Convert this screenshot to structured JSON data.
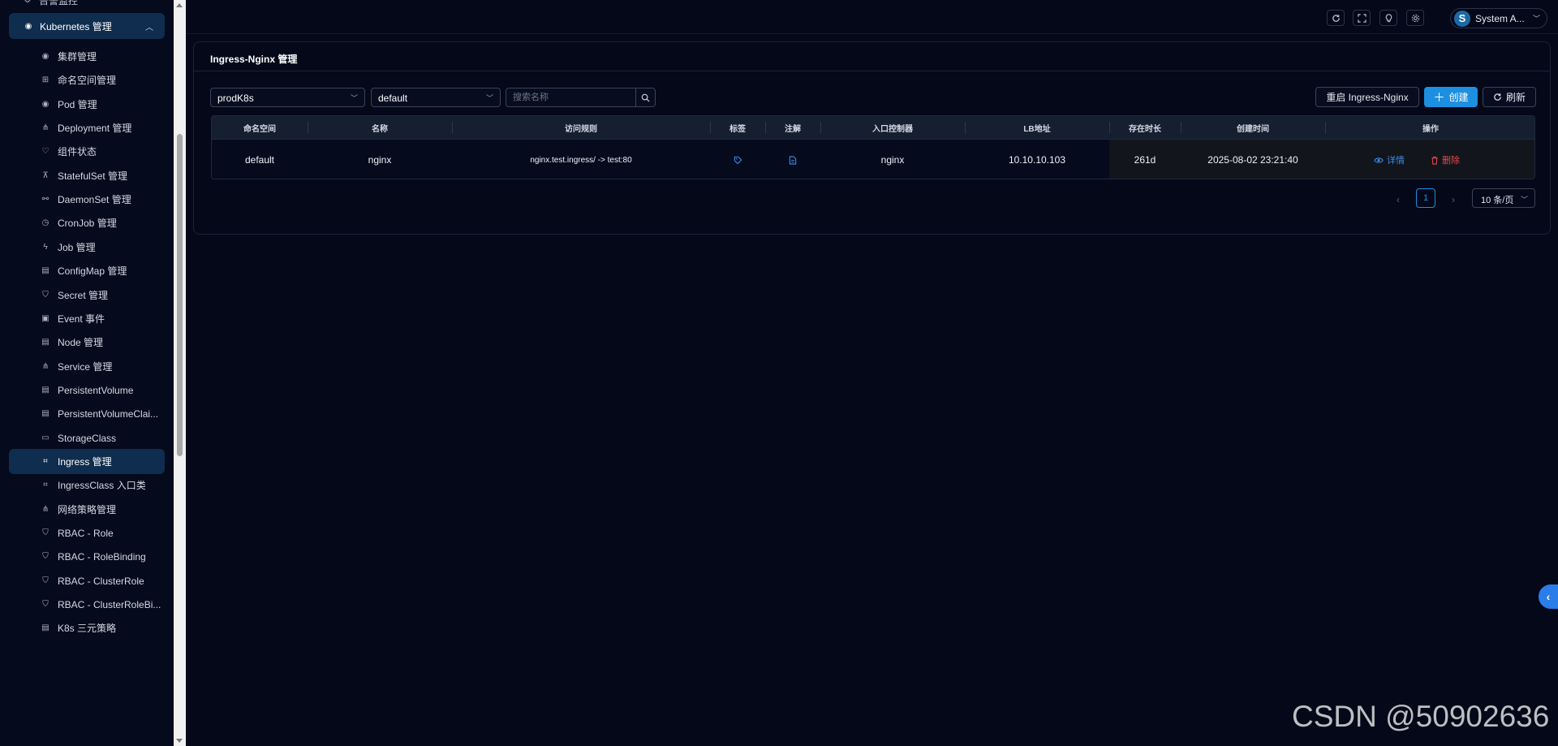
{
  "sidebar": {
    "top_partial": "告警监控",
    "group": {
      "label": "Kubernetes 管理",
      "icon": "kubernetes-icon"
    },
    "items": [
      {
        "label": "集群管理",
        "icon": "cluster-icon",
        "active": false
      },
      {
        "label": "命名空间管理",
        "icon": "grid-icon",
        "active": false
      },
      {
        "label": "Pod 管理",
        "icon": "pod-icon",
        "active": false
      },
      {
        "label": "Deployment 管理",
        "icon": "deployment-icon",
        "active": false
      },
      {
        "label": "组件状态",
        "icon": "heart-icon",
        "active": false
      },
      {
        "label": "StatefulSet 管理",
        "icon": "statefulset-icon",
        "active": false
      },
      {
        "label": "DaemonSet 管理",
        "icon": "daemonset-icon",
        "active": false
      },
      {
        "label": "CronJob 管理",
        "icon": "clock-icon",
        "active": false
      },
      {
        "label": "Job 管理",
        "icon": "lightning-icon",
        "active": false
      },
      {
        "label": "ConfigMap 管理",
        "icon": "file-icon",
        "active": false
      },
      {
        "label": "Secret 管理",
        "icon": "shield-icon",
        "active": false
      },
      {
        "label": "Event 事件",
        "icon": "event-icon",
        "active": false
      },
      {
        "label": "Node 管理",
        "icon": "node-icon",
        "active": false
      },
      {
        "label": "Service 管理",
        "icon": "service-icon",
        "active": false
      },
      {
        "label": "PersistentVolume",
        "icon": "volume-icon",
        "active": false
      },
      {
        "label": "PersistentVolumeClai...",
        "icon": "volume-claim-icon",
        "active": false
      },
      {
        "label": "StorageClass",
        "icon": "folder-icon",
        "active": false
      },
      {
        "label": "Ingress 管理",
        "icon": "ingress-icon",
        "active": true
      },
      {
        "label": "IngressClass 入口类",
        "icon": "ingress-class-icon",
        "active": false
      },
      {
        "label": "网络策略管理",
        "icon": "network-policy-icon",
        "active": false
      },
      {
        "label": "RBAC - Role",
        "icon": "shield-icon",
        "active": false
      },
      {
        "label": "RBAC - RoleBinding",
        "icon": "shield-icon",
        "active": false
      },
      {
        "label": "RBAC - ClusterRole",
        "icon": "shield-icon",
        "active": false
      },
      {
        "label": "RBAC - ClusterRoleBi...",
        "icon": "shield-icon",
        "active": false
      },
      {
        "label": "K8s 三元策略",
        "icon": "policy-icon",
        "active": false
      }
    ]
  },
  "header": {
    "buttons": [
      "refresh-icon",
      "fullscreen-icon",
      "lightbulb-icon",
      "settings-icon"
    ],
    "user": {
      "avatar_letter": "S",
      "name": "System A..."
    }
  },
  "card": {
    "title": "Ingress-Nginx 管理",
    "cluster_select": "prodK8s",
    "namespace_select": "default",
    "search_placeholder": "搜索名称",
    "restart_label": "重启 Ingress-Nginx",
    "create_label": "创建",
    "refresh_label": "刷新"
  },
  "table": {
    "columns": [
      "命名空间",
      "名称",
      "访问规则",
      "标签",
      "注解",
      "入口控制器",
      "LB地址",
      "存在时长",
      "创建时间",
      "操作"
    ],
    "rows": [
      {
        "namespace": "default",
        "name": "nginx",
        "rule": "nginx.test.ingress/ -> test:80",
        "labels_icon": "tag-icon",
        "annotations_icon": "document-icon",
        "controller": "nginx",
        "lb": "10.10.10.103",
        "age": "261d",
        "created": "2025-08-02 23:21:40",
        "detail_label": "详情",
        "delete_label": "删除"
      }
    ]
  },
  "pagination": {
    "current": "1",
    "page_size": "10 条/页"
  },
  "watermark": "CSDN @50902636",
  "colors": {
    "accent": "#1d8fe0",
    "danger": "#e5484d",
    "active_bg": "#0f2d4e"
  }
}
